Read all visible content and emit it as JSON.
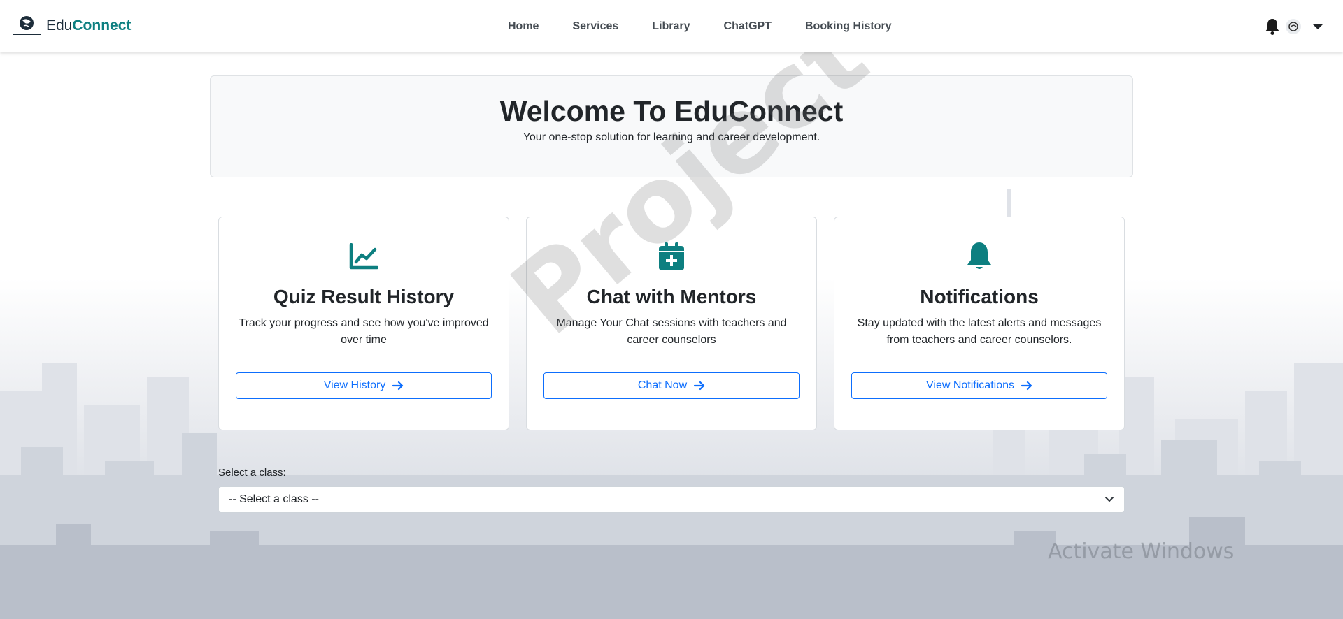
{
  "brand": {
    "edu": "Edu",
    "connect": "Connect"
  },
  "nav": {
    "links": [
      "Home",
      "Services",
      "Library",
      "ChatGPT",
      "Booking History"
    ]
  },
  "hero": {
    "title": "Welcome To EduConnect",
    "subtitle": "Your one-stop solution for learning and career development."
  },
  "cards": [
    {
      "icon": "chart-line-icon",
      "title": "Quiz Result History",
      "text": "Track your progress and see how you've improved over time",
      "button": "View History"
    },
    {
      "icon": "calendar-plus-icon",
      "title": "Chat with Mentors",
      "text": "Manage Your Chat sessions with teachers and career counselors",
      "button": "Chat Now"
    },
    {
      "icon": "bell-icon",
      "title": "Notifications",
      "text": "Stay updated with the latest alerts and messages from teachers and career counselors.",
      "button": "View Notifications"
    }
  ],
  "class_select": {
    "label": "Select a class:",
    "selected": "-- Select a class --"
  },
  "watermark": "Project Stor",
  "os_overlay": {
    "title": "Activate Windows",
    "subtitle": ""
  },
  "colors": {
    "accent": "#0d7f80",
    "button": "#0d6efd",
    "hero_bg": "#f8f9fa"
  }
}
